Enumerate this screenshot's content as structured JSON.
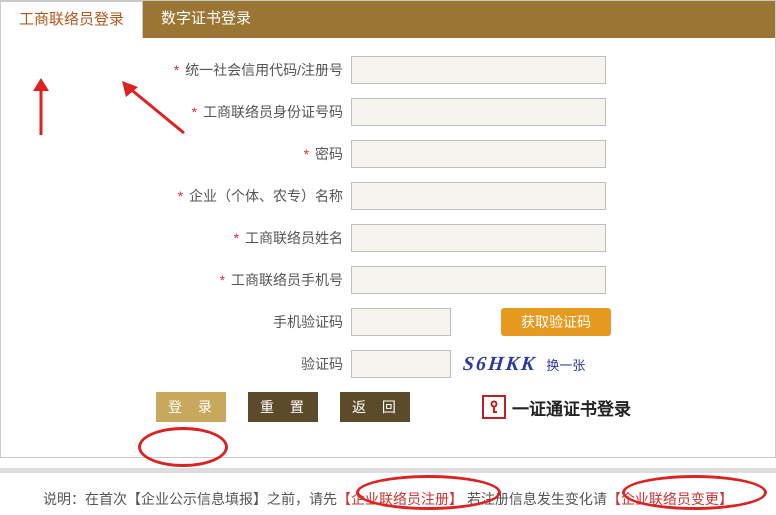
{
  "tabs": {
    "active": "工商联络员登录",
    "inactive": "数字证书登录"
  },
  "fields": {
    "credit_code": {
      "label": "统一社会信用代码/注册号"
    },
    "id_number": {
      "label": "工商联络员身份证号码"
    },
    "password": {
      "label": "密码"
    },
    "org_name": {
      "label": "企业（个体、农专）名称"
    },
    "contact_name": {
      "label": "工商联络员姓名"
    },
    "contact_phone": {
      "label": "工商联络员手机号"
    },
    "sms_code": {
      "label": "手机验证码"
    },
    "captcha": {
      "label": "验证码"
    }
  },
  "buttons": {
    "get_code": "获取验证码",
    "login": "登 录",
    "reset": "重 置",
    "back": "返 回",
    "cert_login": "一证通证书登录"
  },
  "captcha": {
    "text": "S6HKK",
    "change": "换一张"
  },
  "footer": {
    "prefix": "说明：在首次【企业公示信息填报】之前，请先",
    "link1_bracket_open": "【",
    "link1": "企业联络员注册",
    "link1_bracket_close": "】",
    "mid": "若注册信息发生变化请",
    "link2_bracket_open": "【",
    "link2": "企业联络员变更",
    "link2_bracket_close": "】"
  }
}
